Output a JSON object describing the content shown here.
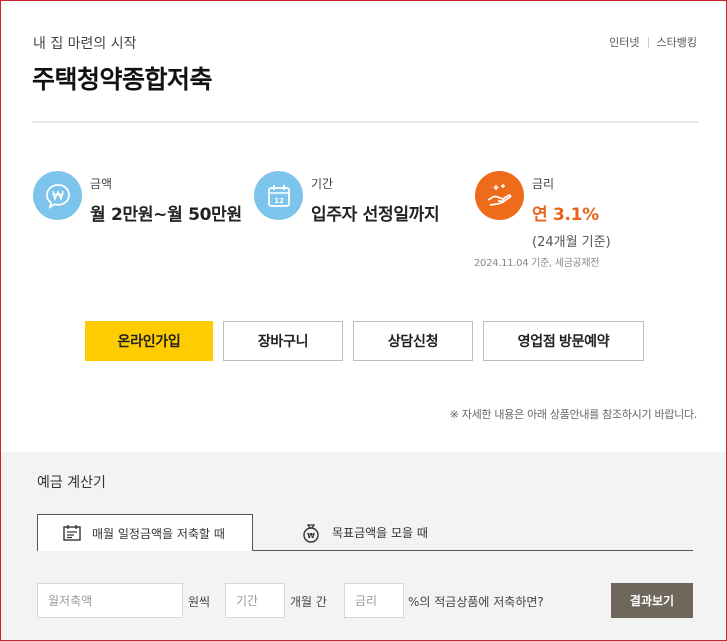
{
  "header": {
    "subtitle": "내 집 마련의 시작",
    "title": "주택청약종합저축",
    "links": [
      "인터넷",
      "스타뱅킹"
    ]
  },
  "info": {
    "amount": {
      "label": "금액",
      "value": "월 2만원~월 50만원",
      "icon": "won-speech-icon"
    },
    "period": {
      "label": "기간",
      "value": "입주자 선정일까지",
      "icon": "calendar-icon"
    },
    "rate": {
      "label": "금리",
      "value": "연 3.1%",
      "sub": "(24개월 기준)",
      "icon": "hand-sparkle-icon"
    },
    "rate_note": "2024.11.04 기준, 세금공제전"
  },
  "actions": {
    "join": "온라인가입",
    "cart": "장바구니",
    "consult": "상담신청",
    "visit": "영업점 방문예약"
  },
  "footnote": "※ 자세한 내용은 아래 상품안내를 참조하시기 바랍니다.",
  "calculator": {
    "title": "예금 계산기",
    "tabs": [
      {
        "label": "매월 일정금액을 저축할 때",
        "icon": "calculator-icon",
        "active": true
      },
      {
        "label": "목표금액을 모을 때",
        "icon": "money-bag-icon",
        "active": false
      }
    ],
    "monthly_placeholder": "월저축액",
    "monthly_unit": "원씩",
    "period_placeholder": "기간",
    "period_unit": "개월 간",
    "rate_placeholder": "금리",
    "rate_unit": "%의 적금상품에 저축하면?",
    "result_button": "결과보기"
  },
  "colors": {
    "primary_button": "#ffcc00",
    "icon_blue": "#7dc4ec",
    "icon_orange": "#ee6b1c",
    "rate_text": "#e8641a",
    "result_button": "#6f665c",
    "frame": "#c9272d"
  }
}
